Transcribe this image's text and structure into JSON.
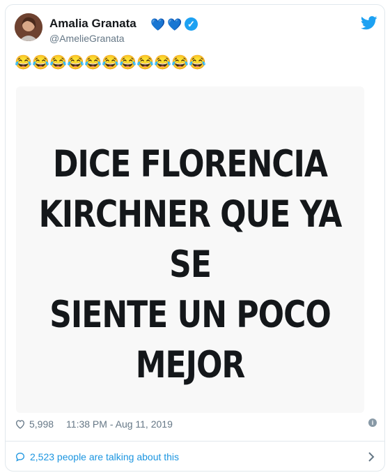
{
  "tweet": {
    "author_name": "Amalia Granata",
    "handle": "@AmelieGranata",
    "verified": true,
    "name_emojis": [
      "💙",
      "💙"
    ],
    "body_emoji": "😂",
    "body_emoji_count": 11,
    "image_text": "DICE FLORENCIA KIRCHNER QUE YA SE SIENTE UN POCO MEJOR",
    "image_lines": [
      "DICE FLORENCIA",
      "KIRCHNER QUE YA SE",
      "SIENTE UN POCO",
      "MEJOR"
    ],
    "likes": "5,998",
    "timestamp": "11:38 PM - Aug 11, 2019",
    "talking": "2,523 people are talking about this"
  },
  "colors": {
    "twitter_blue": "#1da1f2",
    "link_blue": "#1b95e0",
    "muted": "#657786",
    "border": "#e1e8ed",
    "heart_blue": "#5db3ef"
  },
  "icons": {
    "brand": "twitter-bird-icon",
    "verified": "verified-badge-icon",
    "like": "heart-outline-icon",
    "info": "info-icon",
    "conversation": "speech-bubble-icon",
    "chevron": "chevron-right-icon"
  }
}
